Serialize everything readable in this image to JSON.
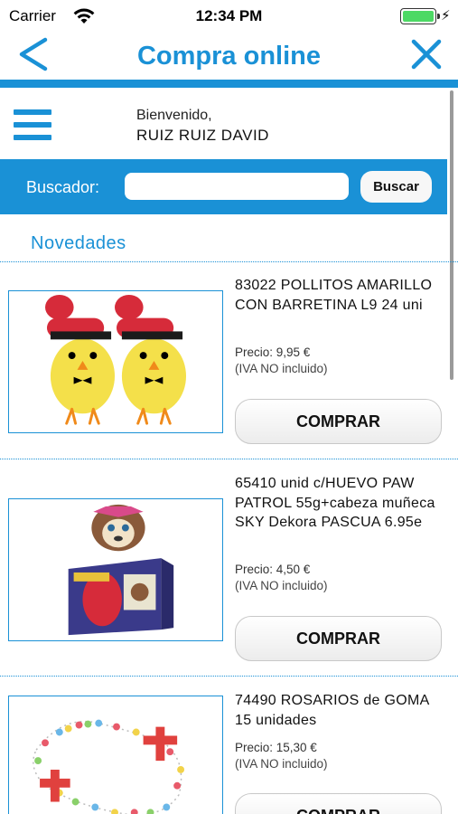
{
  "status_bar": {
    "carrier": "Carrier",
    "time": "12:34 PM",
    "battery_level": 1.0,
    "wifi_icon": "wifi-icon",
    "charging_icon": "bolt-icon"
  },
  "nav": {
    "title": "Compra online",
    "back_icon": "chevron-left-icon",
    "close_icon": "close-icon"
  },
  "welcome": {
    "menu_icon": "hamburger-menu-icon",
    "label": "Bienvenido,",
    "user": "RUIZ RUIZ DAVID"
  },
  "search": {
    "label": "Buscador:",
    "value": "",
    "placeholder": "",
    "button_label": "Buscar"
  },
  "section": {
    "title": "Novedades"
  },
  "products": [
    {
      "title": "83022 POLLITOS AMARILLO CON BARRETINA L9 24 uni",
      "price": "Precio: 9,95 €",
      "vat": "(IVA NO incluido)",
      "button": "COMPRAR"
    },
    {
      "title": "65410 unid c/HUEVO PAW PATROL 55g+cabeza muñeca SKY Dekora PASCUA 6.95e",
      "price": "Precio: 4,50 €",
      "vat": "(IVA NO incluido)",
      "button": "COMPRAR"
    },
    {
      "title": "74490 ROSARIOS de GOMA 15 unidades",
      "price": "Precio: 15,30 €",
      "vat": "(IVA NO incluido)",
      "button": "COMPRAR"
    }
  ],
  "colors": {
    "accent": "#1a91d6",
    "battery": "#4cd964"
  }
}
